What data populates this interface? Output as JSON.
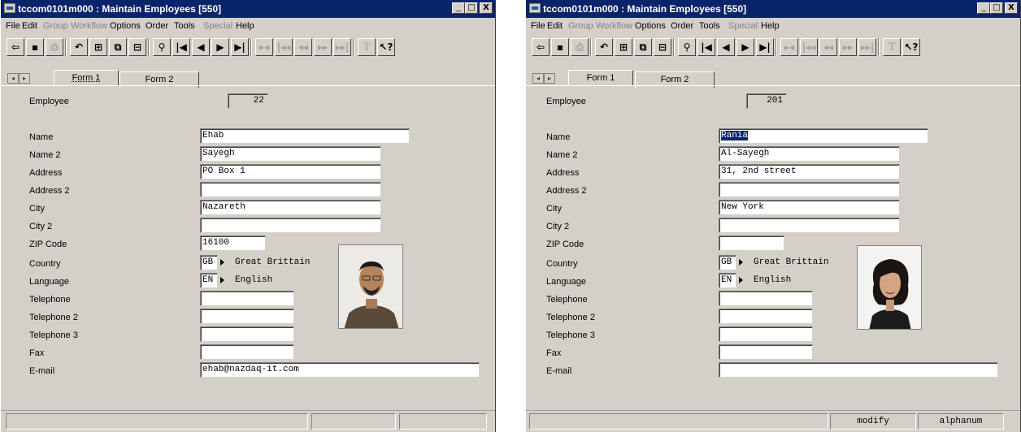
{
  "windows": [
    {
      "title": "tccom0101m000 : Maintain Employees [550]",
      "caption_buttons": {
        "minimize": "_",
        "maximize": "□",
        "close": "X"
      },
      "menu": [
        "File",
        "Edit",
        "Group",
        "Workflow",
        "Options",
        "Order",
        "Tools",
        "Special",
        "Help"
      ],
      "disabled_menu": [
        "Group",
        "Workflow",
        "Special"
      ],
      "tabs": [
        "Form 1",
        "Form 2"
      ],
      "labels": {
        "employee": "Employee",
        "name": "Name",
        "name2": "Name 2",
        "address": "Address",
        "address2": "Address 2",
        "city": "City",
        "city2": "City 2",
        "zip": "ZIP Code",
        "country": "Country",
        "language": "Language",
        "telephone": "Telephone",
        "telephone2": "Telephone 2",
        "telephone3": "Telephone 3",
        "fax": "Fax",
        "email": "E-mail"
      },
      "values": {
        "employee": "22",
        "name": "Ehab",
        "name2": "Sayegh",
        "address": "PO Box 1",
        "address2": "",
        "city": "Nazareth",
        "city2": "",
        "zip": "16100",
        "country_code": "GB",
        "country_desc": "Great Brittain",
        "language_code": "EN",
        "language_desc": "English",
        "telephone": "",
        "telephone2": "",
        "telephone3": "",
        "fax": "",
        "email": "ehab@nazdaq-it.com"
      },
      "status": [
        "",
        "",
        ""
      ]
    },
    {
      "title": "tccom0101m000 : Maintain Employees [550]",
      "caption_buttons": {
        "minimize": "_",
        "maximize": "□",
        "close": "X"
      },
      "menu": [
        "File",
        "Edit",
        "Group",
        "Workflow",
        "Options",
        "Order",
        "Tools",
        "Special",
        "Help"
      ],
      "disabled_menu": [
        "Group",
        "Workflow",
        "Special"
      ],
      "tabs": [
        "Form 1",
        "Form 2"
      ],
      "labels": {
        "employee": "Employee",
        "name": "Name",
        "name2": "Name 2",
        "address": "Address",
        "address2": "Address 2",
        "city": "City",
        "city2": "City 2",
        "zip": "ZIP Code",
        "country": "Country",
        "language": "Language",
        "telephone": "Telephone",
        "telephone2": "Telephone 2",
        "telephone3": "Telephone 3",
        "fax": "Fax",
        "email": "E-mail"
      },
      "values": {
        "employee": "201",
        "name": "Rania",
        "name2": "Al-Sayegh",
        "address": "31, 2nd street",
        "address2": "",
        "city": "New York",
        "city2": "",
        "zip": "",
        "country_code": "GB",
        "country_desc": "Great Brittain",
        "language_code": "EN",
        "language_desc": "English",
        "telephone": "",
        "telephone2": "",
        "telephone3": "",
        "fax": "",
        "email": ""
      },
      "status": [
        "",
        "modify",
        "alphanum"
      ]
    }
  ],
  "toolbar_icons": [
    "exit-icon",
    "save-icon",
    "print-icon",
    "undo-icon",
    "insert-record-icon",
    "copy-record-icon",
    "delete-record-icon",
    "find-icon",
    "first-record-icon",
    "previous-record-icon",
    "next-record-icon",
    "last-record-icon",
    "first-group-icon",
    "previous-group-icon",
    "previous-set-icon",
    "next-set-icon",
    "last-group-icon",
    "text-icon",
    "help-icon"
  ]
}
